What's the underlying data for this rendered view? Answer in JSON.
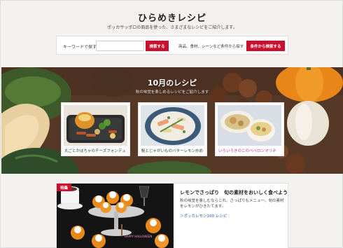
{
  "header": {
    "title": "ひらめきレシピ",
    "subtitle": "ポッカサッポロの商品を使った、さまざまなレシピをご紹介します。"
  },
  "search": {
    "keyword_label": "キーワードで探す",
    "keyword_value": "",
    "keyword_button": "検索する",
    "conditions_label": "商品、食材、シーンなど条件から探す",
    "conditions_button": "条件から検索する"
  },
  "monthly": {
    "title": "10月のレシピ",
    "subtitle": "秋の味覚を楽しめるレシピをご紹介します",
    "cards": [
      {
        "caption": "丸ごとかぼちゃのチーズフォンデュ",
        "caption_color": "#333333"
      },
      {
        "caption": "鮭とじゃがいものバターレモン炒め",
        "caption_color": "#333333"
      },
      {
        "caption": "いろいろきのこのペペロンマリネ",
        "caption_color": "#b0358e"
      }
    ]
  },
  "feature": {
    "badge": "特集",
    "title": "レモンでさっぱり　旬の素材をおいしく食べよう",
    "description": "秋の味覚を楽しむならこれ、さっぱりもメニュー。旬の素材をレモンがひきたてます。",
    "link": "＞ポッカレモン100 レシピ",
    "image_text": "HAPPY HALLOWEEN"
  },
  "colors": {
    "accent": "#c8102e",
    "link": "#1a5bb8"
  }
}
